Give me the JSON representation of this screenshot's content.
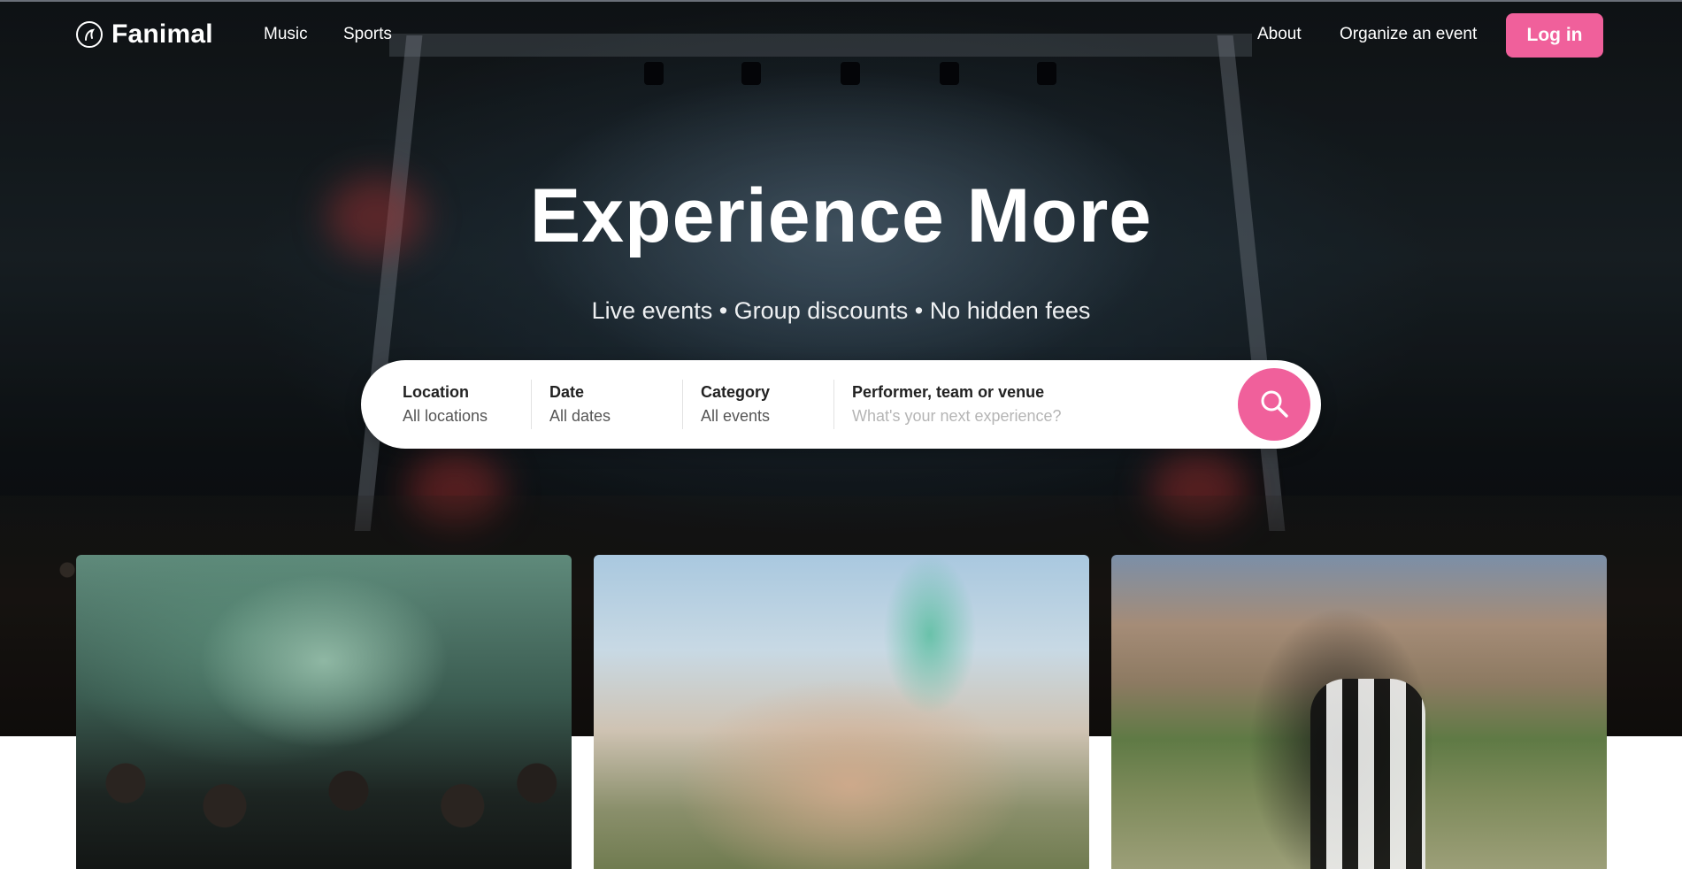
{
  "brand": {
    "name": "Fanimal",
    "icon": "fanimal-logo-icon",
    "accent_color": "#f0609b"
  },
  "nav": {
    "left_links": [
      "Music",
      "Sports"
    ],
    "right_links": [
      "About",
      "Organize an event"
    ],
    "login_label": "Log in"
  },
  "hero": {
    "title": "Experience More",
    "subtitle": "Live events • Group discounts • No hidden fees"
  },
  "search": {
    "location_label": "Location",
    "location_value": "All locations",
    "date_label": "Date",
    "date_value": "All dates",
    "category_label": "Category",
    "category_value": "All events",
    "query_label": "Performer, team or venue",
    "query_placeholder": "What's your next experience?",
    "button_icon": "search-icon"
  },
  "cards": [
    {
      "image": "concert-crowd-surfer-photo"
    },
    {
      "image": "festival-friends-photo"
    },
    {
      "image": "football-referee-photo"
    }
  ]
}
